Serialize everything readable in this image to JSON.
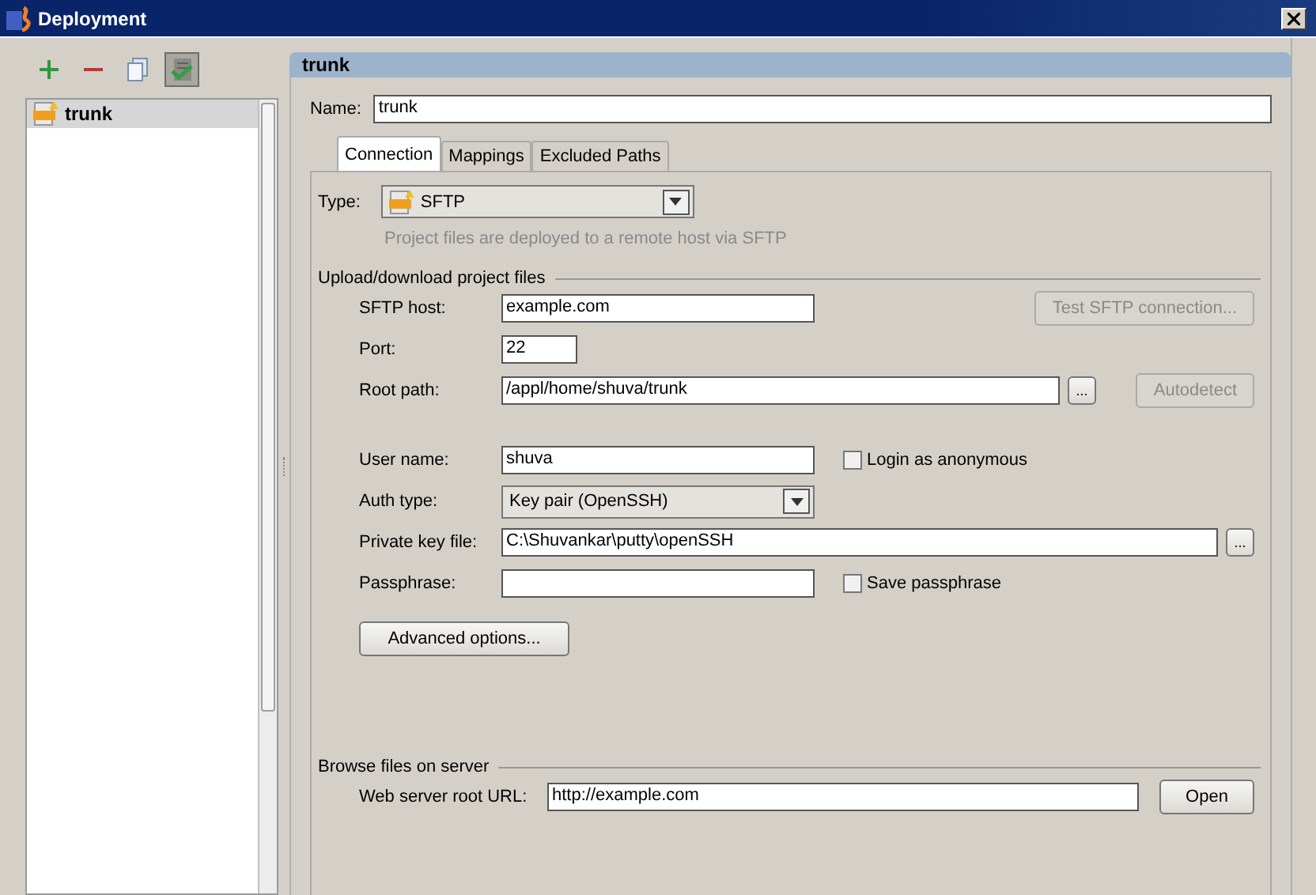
{
  "window": {
    "title": "Deployment"
  },
  "toolbar": [
    {
      "kind": "add"
    },
    {
      "kind": "remove"
    },
    {
      "kind": "copy"
    },
    {
      "kind": "default",
      "pressed": true
    }
  ],
  "servers": [
    {
      "label": "trunk",
      "selected": true
    }
  ],
  "header": "trunk",
  "name": {
    "label": "Name:",
    "value": "trunk"
  },
  "tabs": [
    {
      "label": "Connection",
      "selected": true
    },
    {
      "label": "Mappings",
      "selected": false
    },
    {
      "label": "Excluded Paths",
      "selected": false
    }
  ],
  "type": {
    "label": "Type:",
    "value": "SFTP",
    "hint": "Project files are deployed to a remote host via SFTP"
  },
  "sections": [
    {
      "title": "Upload/download project files",
      "rows": [
        {
          "kind": "text",
          "label": "SFTP host:",
          "value": "example.com",
          "button": {
            "label": "Test SFTP connection...",
            "disabled": true
          }
        },
        {
          "kind": "text",
          "label": "Port:",
          "value": "22"
        },
        {
          "kind": "text",
          "label": "Root path:",
          "value": "/appl/home/shuva/trunk",
          "browse": "...",
          "button": {
            "label": "Autodetect",
            "disabled": true
          }
        },
        {
          "kind": "spacer"
        },
        {
          "kind": "text",
          "label": "User name:",
          "value": "shuva",
          "checkbox": {
            "label": "Login as anonymous",
            "checked": false
          }
        },
        {
          "kind": "combo",
          "label": "Auth type:",
          "value": "Key pair (OpenSSH)"
        },
        {
          "kind": "text",
          "label": "Private key file:",
          "value": "C:\\Shuvankar\\putty\\openSSH",
          "browse": "..."
        },
        {
          "kind": "text",
          "label": "Passphrase:",
          "value": "",
          "checkbox": {
            "label": "Save passphrase",
            "checked": false
          }
        },
        {
          "kind": "action",
          "button": {
            "label": "Advanced options...",
            "disabled": false
          }
        }
      ]
    },
    {
      "title": "Browse files on server",
      "rows": [
        {
          "kind": "text",
          "label": "Web server root URL:",
          "value": "http://example.com",
          "button": {
            "label": "Open",
            "disabled": false
          }
        }
      ]
    }
  ]
}
